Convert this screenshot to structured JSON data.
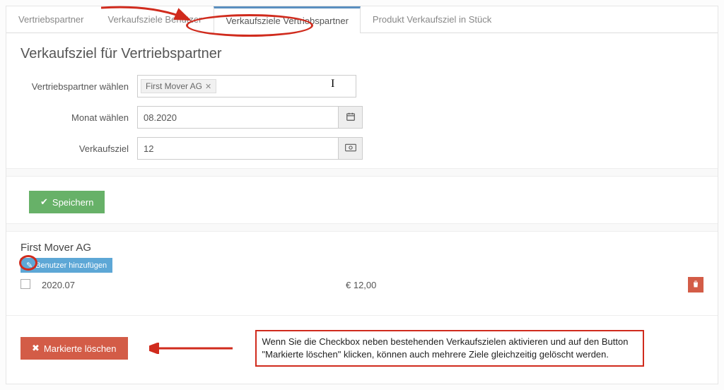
{
  "tabs": [
    {
      "label": "Vertriebspartner"
    },
    {
      "label": "Verkaufsziele Benutzer"
    },
    {
      "label": "Verkaufsziele Vertriebspartner"
    },
    {
      "label": "Produkt Verkaufsziel in Stück"
    }
  ],
  "active_tab_index": 2,
  "page_title": "Verkaufsziel für Vertriebspartner",
  "form": {
    "partner_label": "Vertriebspartner wählen",
    "partner_tag": "First Mover AG",
    "month_label": "Monat wählen",
    "month_value": "08.2020",
    "goal_label": "Verkaufsziel",
    "goal_value": "12"
  },
  "buttons": {
    "save": "Speichern",
    "add_user": "Benutzer hinzufügen",
    "delete_marked": "Markierte löschen"
  },
  "partner_block": {
    "name": "First Mover AG",
    "rows": [
      {
        "date": "2020.07",
        "amount": "€ 12,00"
      }
    ]
  },
  "annotation_text": "Wenn Sie die Checkbox neben bestehenden Verkaufszielen aktivieren und auf den Button \"Markierte löschen\" klicken, können auch mehrere Ziele gleichzeitig gelöscht werden.",
  "colors": {
    "annotation": "#d02b1d",
    "btn_green": "#67b168",
    "btn_red": "#d35c47",
    "btn_blue": "#5da7d6"
  }
}
